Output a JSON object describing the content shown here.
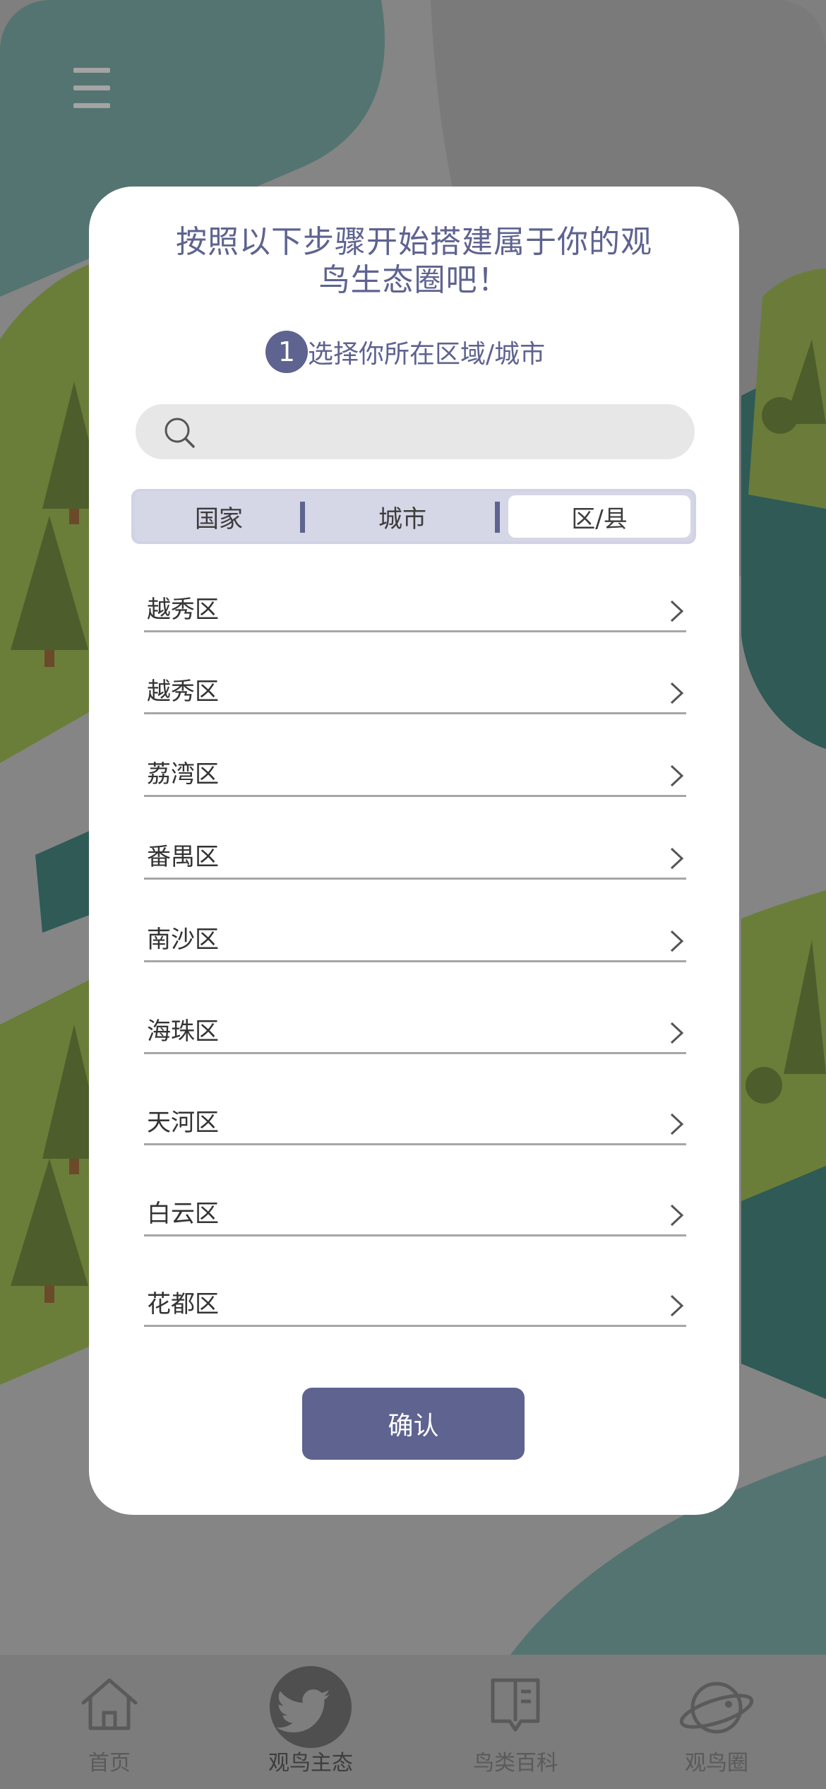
{
  "header": {
    "menu_icon": "hamburger-menu-icon"
  },
  "modal": {
    "title_line1": "按照以下步骤开始搭建属于你的观",
    "title_line2": "鸟生态圈吧！",
    "step": {
      "number": "1",
      "text": "选择你所在区域/城市"
    },
    "search": {
      "placeholder": "",
      "value": "",
      "icon": "search-icon"
    },
    "tabs": [
      {
        "label": "国家",
        "selected": false
      },
      {
        "label": "城市",
        "selected": false
      },
      {
        "label": "区/县",
        "selected": true
      }
    ],
    "districts": [
      "越秀区",
      "越秀区",
      "荔湾区",
      "番禺区",
      "南沙区",
      "海珠区",
      "天河区",
      "白云区",
      "花都区"
    ],
    "confirm_label": "确认"
  },
  "tabbar": {
    "items": [
      {
        "label": "首页",
        "icon": "home-icon",
        "active": false
      },
      {
        "label": "观鸟主态",
        "icon": "twitter-bird-icon",
        "active": true
      },
      {
        "label": "鸟类百科",
        "icon": "book-icon",
        "active": false
      },
      {
        "label": "观鸟圈",
        "icon": "planet-icon",
        "active": false
      }
    ]
  },
  "colors": {
    "accent": "#5e6390",
    "tab_track": "#d5d6e6",
    "overlay": "#858585"
  }
}
